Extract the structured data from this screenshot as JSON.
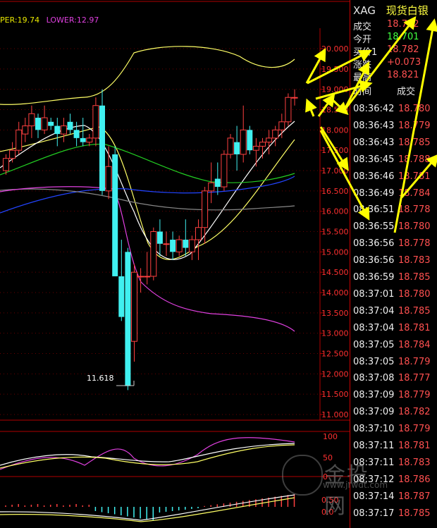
{
  "bollinger": {
    "upper_label": "PER:19.74",
    "lower_label": "LOWER:12.97"
  },
  "low_marker": "11.618",
  "price_axis": [
    "20.000",
    "19.500",
    "19.000",
    "18.500",
    "18.000",
    "17.500",
    "17.000",
    "16.500",
    "16.000",
    "15.500",
    "15.000",
    "14.500",
    "14.000",
    "13.500",
    "13.000",
    "12.500",
    "12.000",
    "11.500",
    "11.000"
  ],
  "indicator_axis": [
    "100",
    "50",
    "0"
  ],
  "macd_axis": [
    "0.50",
    "0.0"
  ],
  "watermark": {
    "cn": "金投网",
    "url": "www.jrwdt.com"
  },
  "quote": {
    "code": "XAG",
    "name": "现货白银",
    "rows": [
      {
        "label": "成交",
        "value": "18.782",
        "color": "#ff5050"
      },
      {
        "label": "今开",
        "value": "18.701",
        "color": "#40ff40"
      },
      {
        "label": "买价1",
        "value": "18.782",
        "color": "#ff5050"
      },
      {
        "label": "涨跌",
        "value": "+0.073",
        "color": "#ff5050"
      },
      {
        "label": "最高",
        "value": "18.821",
        "color": "#ff5050"
      }
    ]
  },
  "trades": {
    "header_time": "时间",
    "header_price": "成交",
    "rows": [
      {
        "time": "08:36:42",
        "price": "18.780"
      },
      {
        "time": "08:36:43",
        "price": "18.779"
      },
      {
        "time": "08:36:43",
        "price": "18.785"
      },
      {
        "time": "08:36:45",
        "price": "18.788"
      },
      {
        "time": "08:36:46",
        "price": "18.781"
      },
      {
        "time": "08:36:49",
        "price": "18.784"
      },
      {
        "time": "08:36:51",
        "price": "18.778"
      },
      {
        "time": "08:36:55",
        "price": "18.780"
      },
      {
        "time": "08:36:56",
        "price": "18.778"
      },
      {
        "time": "08:36:56",
        "price": "18.783"
      },
      {
        "time": "08:36:59",
        "price": "18.785"
      },
      {
        "time": "08:37:01",
        "price": "18.780"
      },
      {
        "time": "08:37:04",
        "price": "18.785"
      },
      {
        "time": "08:37:04",
        "price": "18.781"
      },
      {
        "time": "08:37:05",
        "price": "18.784"
      },
      {
        "time": "08:37:05",
        "price": "18.779"
      },
      {
        "time": "08:37:08",
        "price": "18.777"
      },
      {
        "time": "08:37:09",
        "price": "18.779"
      },
      {
        "time": "08:37:09",
        "price": "18.782"
      },
      {
        "time": "08:37:10",
        "price": "18.779"
      },
      {
        "time": "08:37:11",
        "price": "18.781"
      },
      {
        "time": "08:37:11",
        "price": "18.783"
      },
      {
        "time": "08:37:12",
        "price": "18.786"
      },
      {
        "time": "08:37:14",
        "price": "18.787"
      },
      {
        "time": "08:37:17",
        "price": "18.785"
      }
    ]
  },
  "candles": [
    [
      17.0,
      17.4,
      16.9,
      17.3
    ],
    [
      17.3,
      17.7,
      17.2,
      17.5
    ],
    [
      17.5,
      18.2,
      17.4,
      18.0
    ],
    [
      17.9,
      18.3,
      17.7,
      18.1
    ],
    [
      18.1,
      18.6,
      17.8,
      18.4
    ],
    [
      18.3,
      18.4,
      17.8,
      18.0
    ],
    [
      18.0,
      18.6,
      17.9,
      18.3
    ],
    [
      18.2,
      18.3,
      18.0,
      18.1
    ],
    [
      18.1,
      18.3,
      17.6,
      17.9
    ],
    [
      17.9,
      18.3,
      17.7,
      18.1
    ],
    [
      18.2,
      18.4,
      17.9,
      18.0
    ],
    [
      18.0,
      18.2,
      17.6,
      17.8
    ],
    [
      17.8,
      18.3,
      17.6,
      17.7
    ],
    [
      17.7,
      17.9,
      17.6,
      17.8
    ],
    [
      17.8,
      18.8,
      17.6,
      18.6
    ],
    [
      18.6,
      19.0,
      16.4,
      16.5
    ],
    [
      16.5,
      17.6,
      16.3,
      17.1
    ],
    [
      17.4,
      17.6,
      14.4,
      14.4
    ],
    [
      14.4,
      15.3,
      13.3,
      13.4
    ],
    [
      15.0,
      15.1,
      11.6,
      11.7
    ],
    [
      12.8,
      14.7,
      12.3,
      14.5
    ],
    [
      14.4,
      14.6,
      14.0,
      14.4
    ],
    [
      14.4,
      15.0,
      14.2,
      14.4
    ],
    [
      14.4,
      15.6,
      14.3,
      15.5
    ],
    [
      15.5,
      15.8,
      14.9,
      15.2
    ],
    [
      15.2,
      15.5,
      14.9,
      15.2
    ],
    [
      15.3,
      15.5,
      14.8,
      15.0
    ],
    [
      15.0,
      15.4,
      14.9,
      15.3
    ],
    [
      15.3,
      15.8,
      14.9,
      15.1
    ],
    [
      15.0,
      15.4,
      14.8,
      15.3
    ],
    [
      15.3,
      15.8,
      14.8,
      15.6
    ],
    [
      15.6,
      16.6,
      15.2,
      16.5
    ],
    [
      16.5,
      17.2,
      16.2,
      16.7
    ],
    [
      16.8,
      17.2,
      16.4,
      16.6
    ],
    [
      16.6,
      17.5,
      16.5,
      17.4
    ],
    [
      17.4,
      17.9,
      17.3,
      17.8
    ],
    [
      17.7,
      18.1,
      17.0,
      17.4
    ],
    [
      17.4,
      18.6,
      17.2,
      18.0
    ],
    [
      18.0,
      18.1,
      17.4,
      17.5
    ],
    [
      17.5,
      17.8,
      17.1,
      17.6
    ],
    [
      17.6,
      17.8,
      17.3,
      17.7
    ],
    [
      17.7,
      18.0,
      17.4,
      17.8
    ],
    [
      17.8,
      18.1,
      17.6,
      18.0
    ],
    [
      18.0,
      18.4,
      17.8,
      18.2
    ],
    [
      18.2,
      18.9,
      18.1,
      18.8
    ],
    [
      18.8,
      19.0,
      18.6,
      18.8
    ]
  ]
}
